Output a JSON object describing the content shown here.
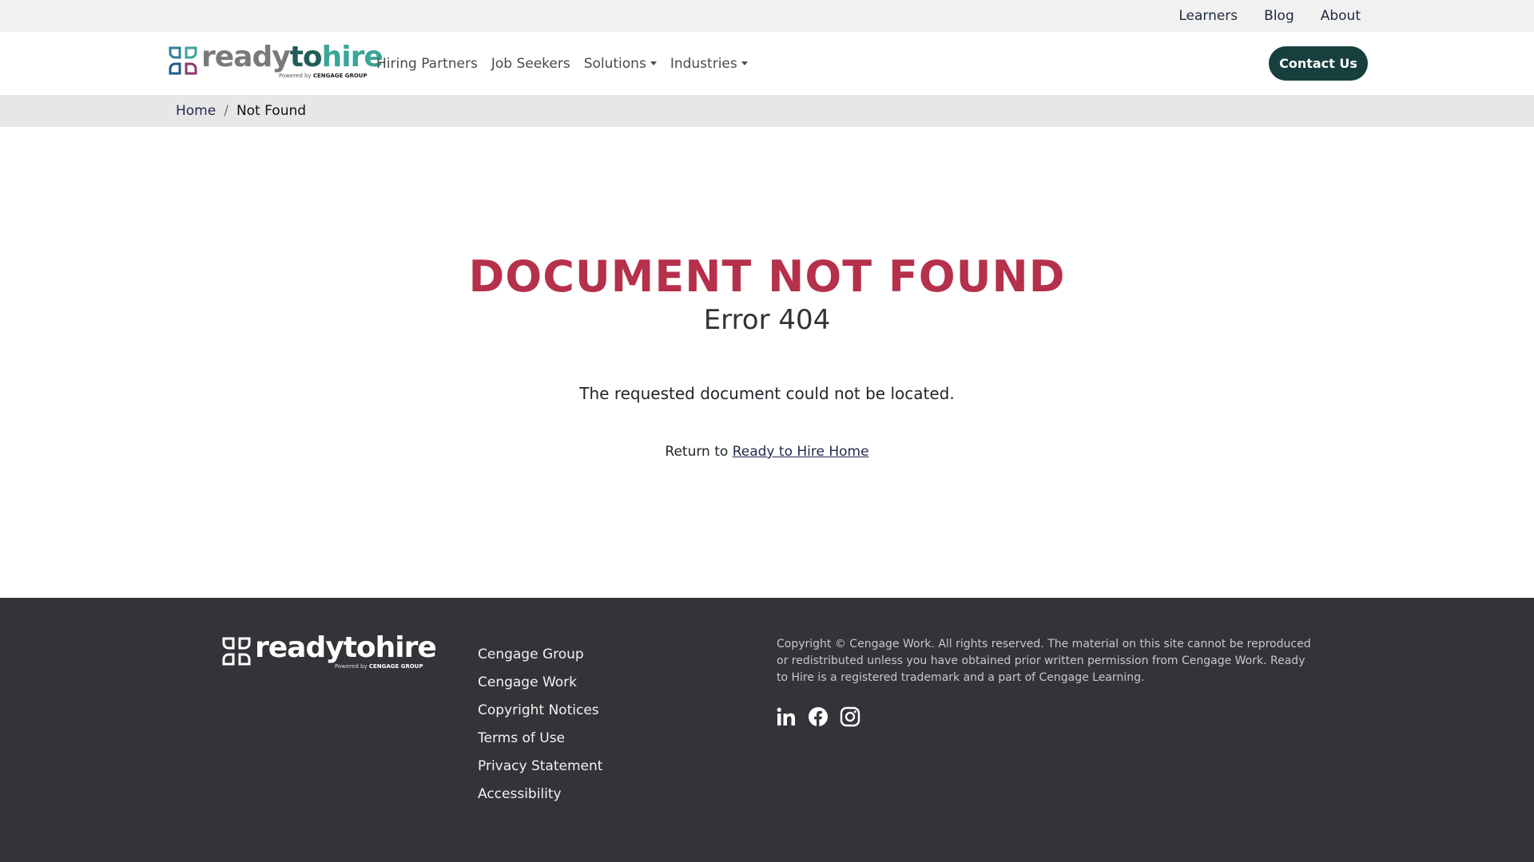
{
  "utility_nav": [
    "Learners",
    "Blog",
    "About"
  ],
  "logo": {
    "word_a": "ready",
    "word_b": "to",
    "word_c": "hire",
    "powered_prefix": "Powered by",
    "powered_brand": "CENGAGE GROUP"
  },
  "main_nav": [
    {
      "label": "Hiring Partners",
      "dropdown": false
    },
    {
      "label": "Job Seekers",
      "dropdown": false
    },
    {
      "label": "Solutions",
      "dropdown": true
    },
    {
      "label": "Industries",
      "dropdown": true
    }
  ],
  "contact_label": "Contact Us",
  "breadcrumb": {
    "home": "Home",
    "separator": "/",
    "current": "Not Found"
  },
  "error": {
    "title": "DOCUMENT NOT FOUND",
    "code": "Error 404",
    "message": "The requested document could not be located.",
    "return_prefix": "Return to",
    "return_link": "Ready to Hire Home"
  },
  "footer": {
    "logo_word": "readytohire",
    "powered_prefix": "Powered by",
    "powered_brand": "CENGAGE GROUP",
    "links": [
      "Cengage Group",
      "Cengage Work",
      "Copyright Notices",
      "Terms of Use",
      "Privacy Statement",
      "Accessibility"
    ],
    "copyright": "Copyright © Cengage Work. All rights reserved. The material on this site cannot be reproduced or redistributed unless you have obtained prior written permission from Cengage Work. Ready to Hire is a registered trademark and a part of Cengage Learning.",
    "social_icons": [
      "linkedin-icon",
      "facebook-icon",
      "instagram-icon"
    ]
  },
  "colors": {
    "accent_red": "#b5304b",
    "brand_dark_teal": "#173f3d",
    "brand_teal": "#3aa698",
    "footer_bg": "#333438"
  }
}
